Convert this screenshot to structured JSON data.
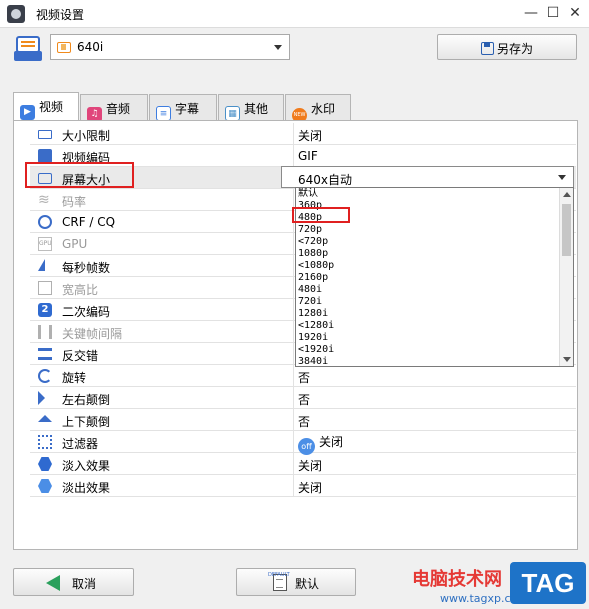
{
  "window": {
    "title": "视频设置",
    "minimize_glyph": "—",
    "maximize_glyph": "☐",
    "close_glyph": "✕"
  },
  "preset": {
    "value": "640i"
  },
  "save_as_label": "另存为",
  "tabs": [
    {
      "label": "视频",
      "icon": "video-tab-icon",
      "color": "#3d7de0"
    },
    {
      "label": "音频",
      "icon": "audio-tab-icon",
      "color": "#e0457b"
    },
    {
      "label": "字幕",
      "icon": "subtitle-tab-icon",
      "color": "#3d7de0"
    },
    {
      "label": "其他",
      "icon": "other-tab-icon",
      "color": "#4a90c8"
    },
    {
      "label": "水印",
      "icon": "watermark-tab-icon",
      "color": "#f07b1c",
      "badge": "NEW"
    }
  ],
  "settings": [
    {
      "label": "大小限制",
      "value": "关闭",
      "icon": "ruler-icon"
    },
    {
      "label": "视频编码",
      "value": "GIF",
      "icon": "chip-icon"
    },
    {
      "label": "屏幕大小",
      "value": "",
      "icon": "screen-icon"
    },
    {
      "label": "码率",
      "value": "",
      "icon": "wave-icon"
    },
    {
      "label": "CRF / CQ",
      "value": "",
      "icon": "gear-icon"
    },
    {
      "label": "GPU",
      "value": "",
      "icon": "gpu-icon",
      "icon_text": "GPU"
    },
    {
      "label": "每秒帧数",
      "value": "",
      "icon": "speed-icon"
    },
    {
      "label": "宽高比",
      "value": "",
      "icon": "aspect-icon"
    },
    {
      "label": "二次编码",
      "value": "",
      "icon": "two-pass-icon",
      "icon_text": "2"
    },
    {
      "label": "关键帧间隔",
      "value": "",
      "icon": "keyframe-icon"
    },
    {
      "label": "反交错",
      "value": "",
      "icon": "deinterlace-icon"
    },
    {
      "label": "旋转",
      "value": "否",
      "icon": "rotate-icon"
    },
    {
      "label": "左右颠倒",
      "value": "否",
      "icon": "flip-horizontal-icon"
    },
    {
      "label": "上下颠倒",
      "value": "否",
      "icon": "flip-vertical-icon"
    },
    {
      "label": "过滤器",
      "value": "关闭",
      "icon": "filter-icon",
      "badge": "off"
    },
    {
      "label": "淡入效果",
      "value": "关闭",
      "icon": "fade-in-icon"
    },
    {
      "label": "淡出效果",
      "value": "关闭",
      "icon": "fade-out-icon"
    }
  ],
  "screen_size": {
    "current": "640x自动",
    "options": [
      "默认",
      "360p",
      "480p",
      "720p",
      "<720p",
      "1080p",
      "<1080p",
      "2160p",
      "480i",
      "720i",
      "1280i",
      "<1280i",
      "1920i",
      "<1920i",
      "3840i"
    ],
    "highlighted": "480p"
  },
  "buttons": {
    "cancel": "取消",
    "default": "默认",
    "default_icon_text": "DEFAULT"
  },
  "watermark": {
    "site": "电脑技术网",
    "url": "www.tagxp.com",
    "badge": "TAG"
  },
  "colors": {
    "accent": "#3a6cc8",
    "highlight_box": "#e02020",
    "watermark_red": "#e53935",
    "watermark_blue": "#1e73c8"
  }
}
